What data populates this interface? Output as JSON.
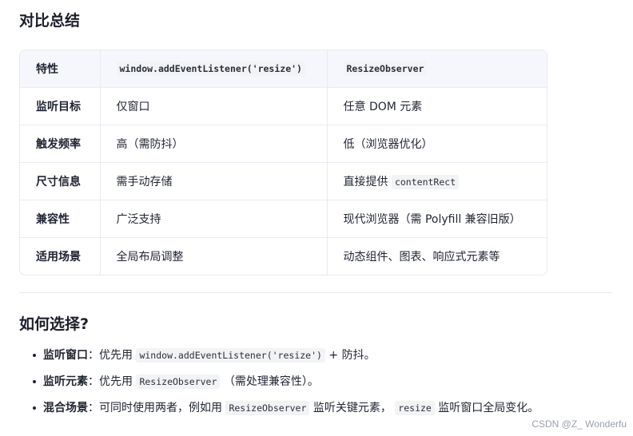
{
  "section1": {
    "title": "对比总结"
  },
  "table": {
    "headers": [
      "特性",
      "window.addEventListener('resize')",
      "ResizeObserver"
    ],
    "rows": [
      {
        "feature": "监听目标",
        "a": "仅窗口",
        "b_text": "任意 DOM 元素",
        "b_code": ""
      },
      {
        "feature": "触发频率",
        "a": "高（需防抖）",
        "b_text": "低（浏览器优化）",
        "b_code": ""
      },
      {
        "feature": "尺寸信息",
        "a": "需手动存储",
        "b_text": "直接提供 ",
        "b_code": "contentRect"
      },
      {
        "feature": "兼容性",
        "a": "广泛支持",
        "b_text": "现代浏览器（需 Polyfill 兼容旧版）",
        "b_code": ""
      },
      {
        "feature": "适用场景",
        "a": "全局布局调整",
        "b_text": "动态组件、图表、响应式元素等",
        "b_code": ""
      }
    ]
  },
  "section2": {
    "title": "如何选择?",
    "items": [
      {
        "label": "监听窗口",
        "sep": "：",
        "t1": "优先用 ",
        "code1": "window.addEventListener('resize')",
        "t2": " + 防抖。",
        "code2": "",
        "t3": ""
      },
      {
        "label": "监听元素",
        "sep": "：",
        "t1": "优先用 ",
        "code1": "ResizeObserver",
        "t2": " （需处理兼容性）。",
        "code2": "",
        "t3": ""
      },
      {
        "label": "混合场景",
        "sep": "：",
        "t1": "可同时使用两者，例如用 ",
        "code1": "ResizeObserver",
        "t2": " 监听关键元素， ",
        "code2": "resize",
        "t3": " 监听窗口全局变化。"
      }
    ]
  },
  "watermark": "CSDN @Z_ Wonderfu"
}
